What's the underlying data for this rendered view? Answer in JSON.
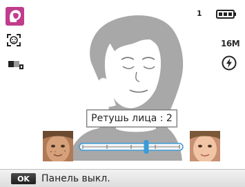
{
  "mode_icon": "beauty-face-icon",
  "left_icons": [
    "face-detect-icon",
    "metering-icon"
  ],
  "status": {
    "shots_remaining": "1",
    "battery_icon": "battery-full-icon",
    "resolution": "16M",
    "flash_icon": "flash-off-icon"
  },
  "retouch": {
    "label": "Ретушь лица : 2",
    "level": 2,
    "min_icon": "face-unretouched-icon",
    "max_icon": "face-retouched-icon"
  },
  "bottom_bar": {
    "ok_key": "OK",
    "text": "Панель выкл."
  },
  "colors": {
    "mode_accent": "#c03c8c",
    "slider_accent": "#3a9bd9",
    "silhouette": "#a8a8a8"
  }
}
